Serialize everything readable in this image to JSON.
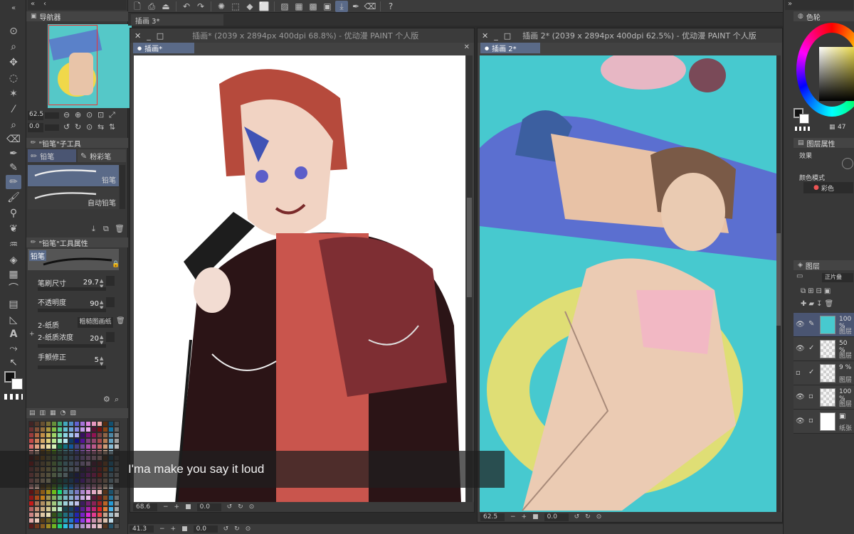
{
  "toolbar": {
    "icons": [
      "new-file-icon",
      "save-icon",
      "upload-icon",
      "undo-icon",
      "redo-icon",
      "spinner-icon",
      "fill-icon",
      "transform-icon",
      "clear-icon",
      "ruler-icon",
      "select-all-icon",
      "pen-icon",
      "eraser-icon",
      "help-icon"
    ]
  },
  "tabs": {
    "top_tab": "插画 3*"
  },
  "navigator": {
    "title": "导航器",
    "zoom": "62.5",
    "angle": "0.0"
  },
  "subtool": {
    "title": "\"铅笔\"子工具",
    "tab_pencil": "铅笔",
    "tab_pastel": "粉彩笔",
    "items": [
      {
        "label": "铅笔"
      },
      {
        "label": "自动铅笔"
      }
    ]
  },
  "tool_props": {
    "title": "\"铅笔\"工具属性",
    "preset": "铅笔",
    "brush_size_label": "笔刷尺寸",
    "brush_size": "29.7",
    "opacity_label": "不透明度",
    "opacity": "90",
    "paper_label": "2-纸质",
    "paper_value": "粗糙图画纸",
    "paper_density_label": "2-纸质浓度",
    "paper_density": "20",
    "stabilize_label": "手颤修正",
    "stabilize": "5"
  },
  "window_left": {
    "title": "插画* (2039 x 2894px 400dpi 68.8%)  - 优动漫 PAINT 个人版",
    "tab": "插画*",
    "zoom": "68.6",
    "angle": "0.0"
  },
  "window_right": {
    "title": "插画 2* (2039 x 2894px 400dpi 62.5%)  - 优动漫 PAINT 个人版",
    "tab": "插画 2*",
    "zoom": "62.5",
    "angle": "0.0"
  },
  "bottom_status": {
    "zoom": "41.3",
    "angle": "0.0"
  },
  "color_wheel": {
    "title": "色轮",
    "value": "47"
  },
  "layer_props": {
    "title": "图层属性",
    "effect_label": "效果",
    "color_mode_label": "颜色模式",
    "color_mode_value": "彩色"
  },
  "layers": {
    "title": "图层",
    "blend": "正片叠",
    "rows": [
      {
        "opacity": "100 %",
        "name": "图层"
      },
      {
        "opacity": "50 %",
        "name": "图层"
      },
      {
        "opacity": "9 %",
        "name": "图层"
      },
      {
        "opacity": "100 %",
        "name": "图层"
      },
      {
        "opacity": "",
        "name": "纸张"
      }
    ]
  },
  "subtitle": {
    "text": "I'ma make you say it loud"
  },
  "colors": {
    "accent": "#5a6a88",
    "panel": "#383838",
    "canvas_bg": "#ffffff"
  }
}
